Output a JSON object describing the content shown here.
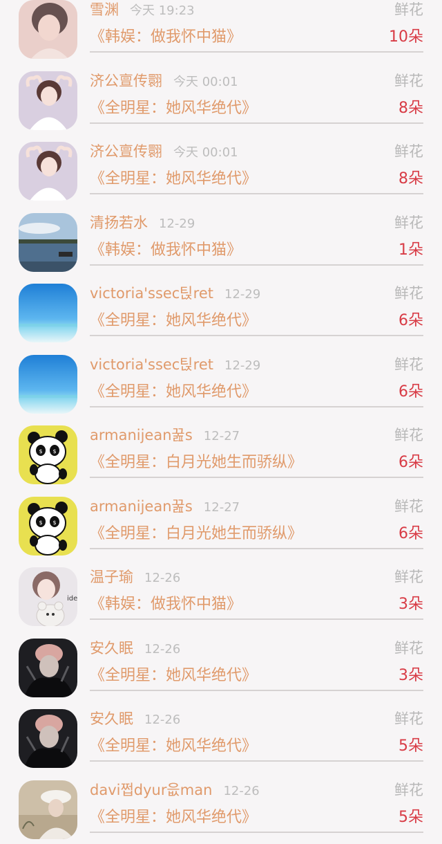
{
  "gift_list": {
    "items": [
      {
        "name": "雪渊",
        "time": "今天 19:23",
        "gift": "鲜花",
        "book": "《韩娱：做我怀中猫》",
        "count": "10朵",
        "avatar": "girl-pink"
      },
      {
        "name": "济公亶传翾",
        "time": "今天 00:01",
        "gift": "鲜花",
        "book": "《全明星：她风华绝代》",
        "count": "8朵",
        "avatar": "girl-heart"
      },
      {
        "name": "济公亶传翾",
        "time": "今天 00:01",
        "gift": "鲜花",
        "book": "《全明星：她风华绝代》",
        "count": "8朵",
        "avatar": "girl-heart"
      },
      {
        "name": "清扬若水",
        "time": "12-29",
        "gift": "鲜花",
        "book": "《韩娱：做我怀中猫》",
        "count": "1朵",
        "avatar": "lake"
      },
      {
        "name": "victoria'ssec틵ret",
        "time": "12-29",
        "gift": "鲜花",
        "book": "《全明星：她风华绝代》",
        "count": "6朵",
        "avatar": "sea"
      },
      {
        "name": "victoria'ssec틵ret",
        "time": "12-29",
        "gift": "鲜花",
        "book": "《全明星：她风华绝代》",
        "count": "6朵",
        "avatar": "sea"
      },
      {
        "name": "armanijean꿆s",
        "time": "12-27",
        "gift": "鲜花",
        "book": "《全明星：白月光她生而骄纵》",
        "count": "6朵",
        "avatar": "panda"
      },
      {
        "name": "armanijean꿆s",
        "time": "12-27",
        "gift": "鲜花",
        "book": "《全明星：白月光她生而骄纵》",
        "count": "6朵",
        "avatar": "panda"
      },
      {
        "name": "温子瑜",
        "time": "12-26",
        "gift": "鲜花",
        "book": "《韩娱：做我怀中猫》",
        "count": "3朵",
        "avatar": "girl-bear"
      },
      {
        "name": "安久眠",
        "time": "12-26",
        "gift": "鲜花",
        "book": "《全明星：她风华绝代》",
        "count": "3朵",
        "avatar": "dark-guy"
      },
      {
        "name": "安久眠",
        "time": "12-26",
        "gift": "鲜花",
        "book": "《全明星：她风华绝代》",
        "count": "5朵",
        "avatar": "dark-guy"
      },
      {
        "name": "davi쩝dyur읎man",
        "time": "12-26",
        "gift": "鲜花",
        "book": "《全明星：她风华绝代》",
        "count": "5朵",
        "avatar": "girl-hat"
      }
    ]
  },
  "colors": {
    "name": "#e09a6b",
    "time": "#bdbdbd",
    "gift_label": "#b8b8b8",
    "count": "#d83b45",
    "divider": "#d6d2d2",
    "background": "#f7f5f6"
  }
}
